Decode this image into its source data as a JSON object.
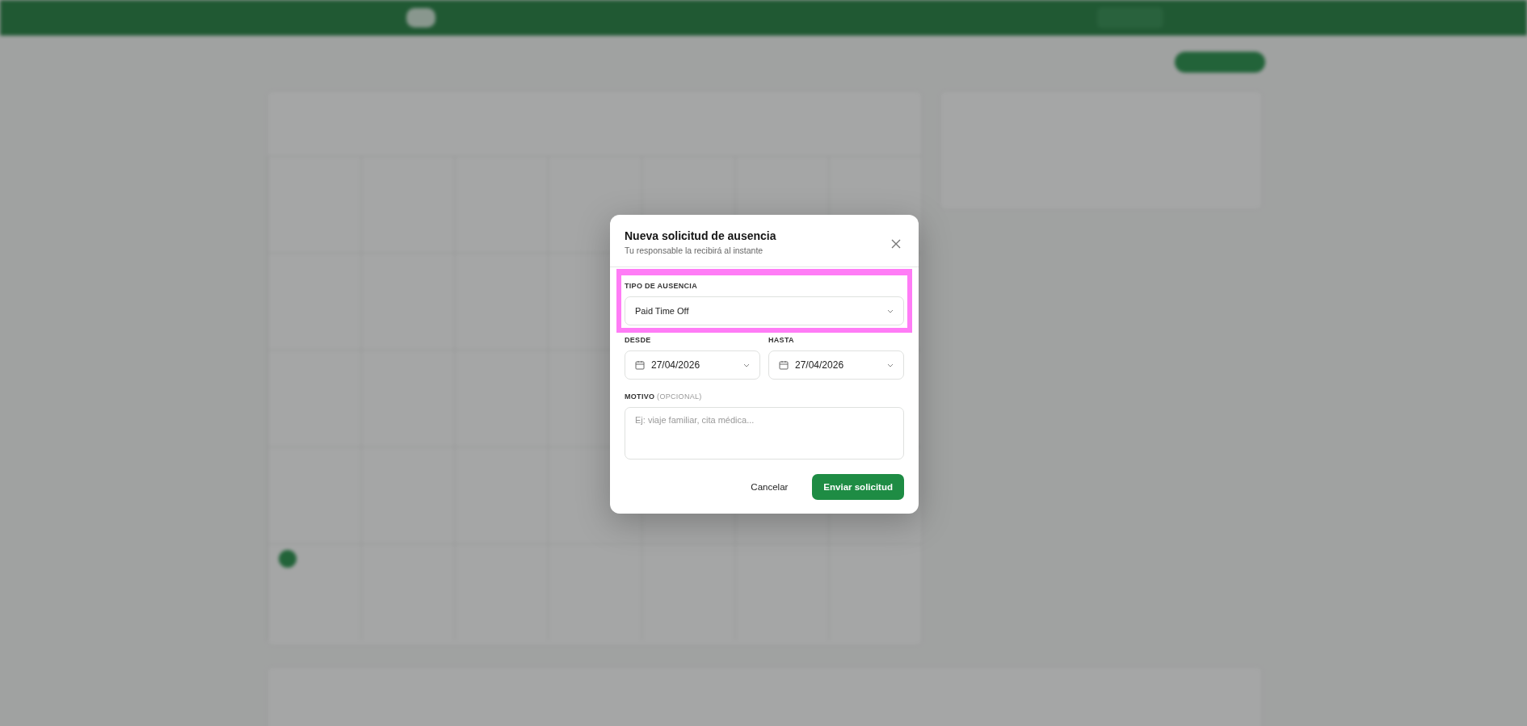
{
  "modal": {
    "title": "Nueva solicitud de ausencia",
    "subtitle": "Tu responsable la recibirá al instante",
    "type_field": {
      "label": "TIPO DE AUSENCIA",
      "value": "Paid Time Off",
      "highlighted": true
    },
    "date_fields": [
      {
        "label": "DESDE",
        "value": "27/04/2026"
      },
      {
        "label": "HASTA",
        "value": "27/04/2026"
      }
    ],
    "reason_field": {
      "label": "MOTIVO",
      "label_note": "(OPCIONAL)",
      "placeholder": "Ej: viaje familiar, cita médica..."
    },
    "buttons": [
      {
        "label": "Cancelar",
        "kind": "secondary"
      },
      {
        "label": "Enviar solicitud",
        "kind": "primary"
      }
    ]
  }
}
